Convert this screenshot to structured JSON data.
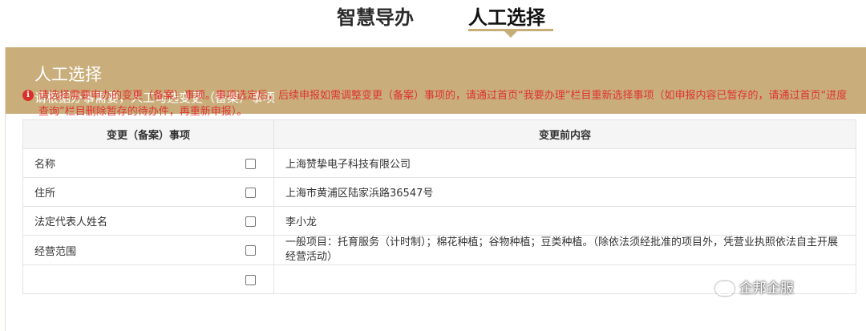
{
  "tabs": [
    {
      "label": "智慧导办"
    },
    {
      "label": "人工选择"
    }
  ],
  "panel": {
    "title": "人工选择",
    "subtitle": "请根据办事需要，人工勾选变更（备案）事项"
  },
  "notice": {
    "icon": "info-icon",
    "text": "请选择需要申办的变更（备案）事项。事项选定后，后续申报如需调整变更（备案）事项的，请通过首页“我要办理”栏目重新选择事项（如申报内容已暂存的，请通过首页“进度查询”栏目删除暂存的待办件，再重新申报）。"
  },
  "table": {
    "headers": [
      "变更（备案）事项",
      "变更前内容"
    ],
    "rows": [
      {
        "item": "名称",
        "content": "上海赞挚电子科技有限公司"
      },
      {
        "item": "住所",
        "content": "上海市黄浦区陆家浜路36547号"
      },
      {
        "item": "法定代表人姓名",
        "content": "李小龙"
      },
      {
        "item": "经营范围",
        "content": "一般项目：托育服务（计时制）；棉花种植；谷物种植；豆类种植。（除依法须经批准的项目外，凭营业执照依法自主开展经营活动）"
      }
    ]
  },
  "watermark": {
    "text": "企邦企服"
  },
  "colors": {
    "accent": "#c9ae7b",
    "notice": "#e0322f"
  }
}
